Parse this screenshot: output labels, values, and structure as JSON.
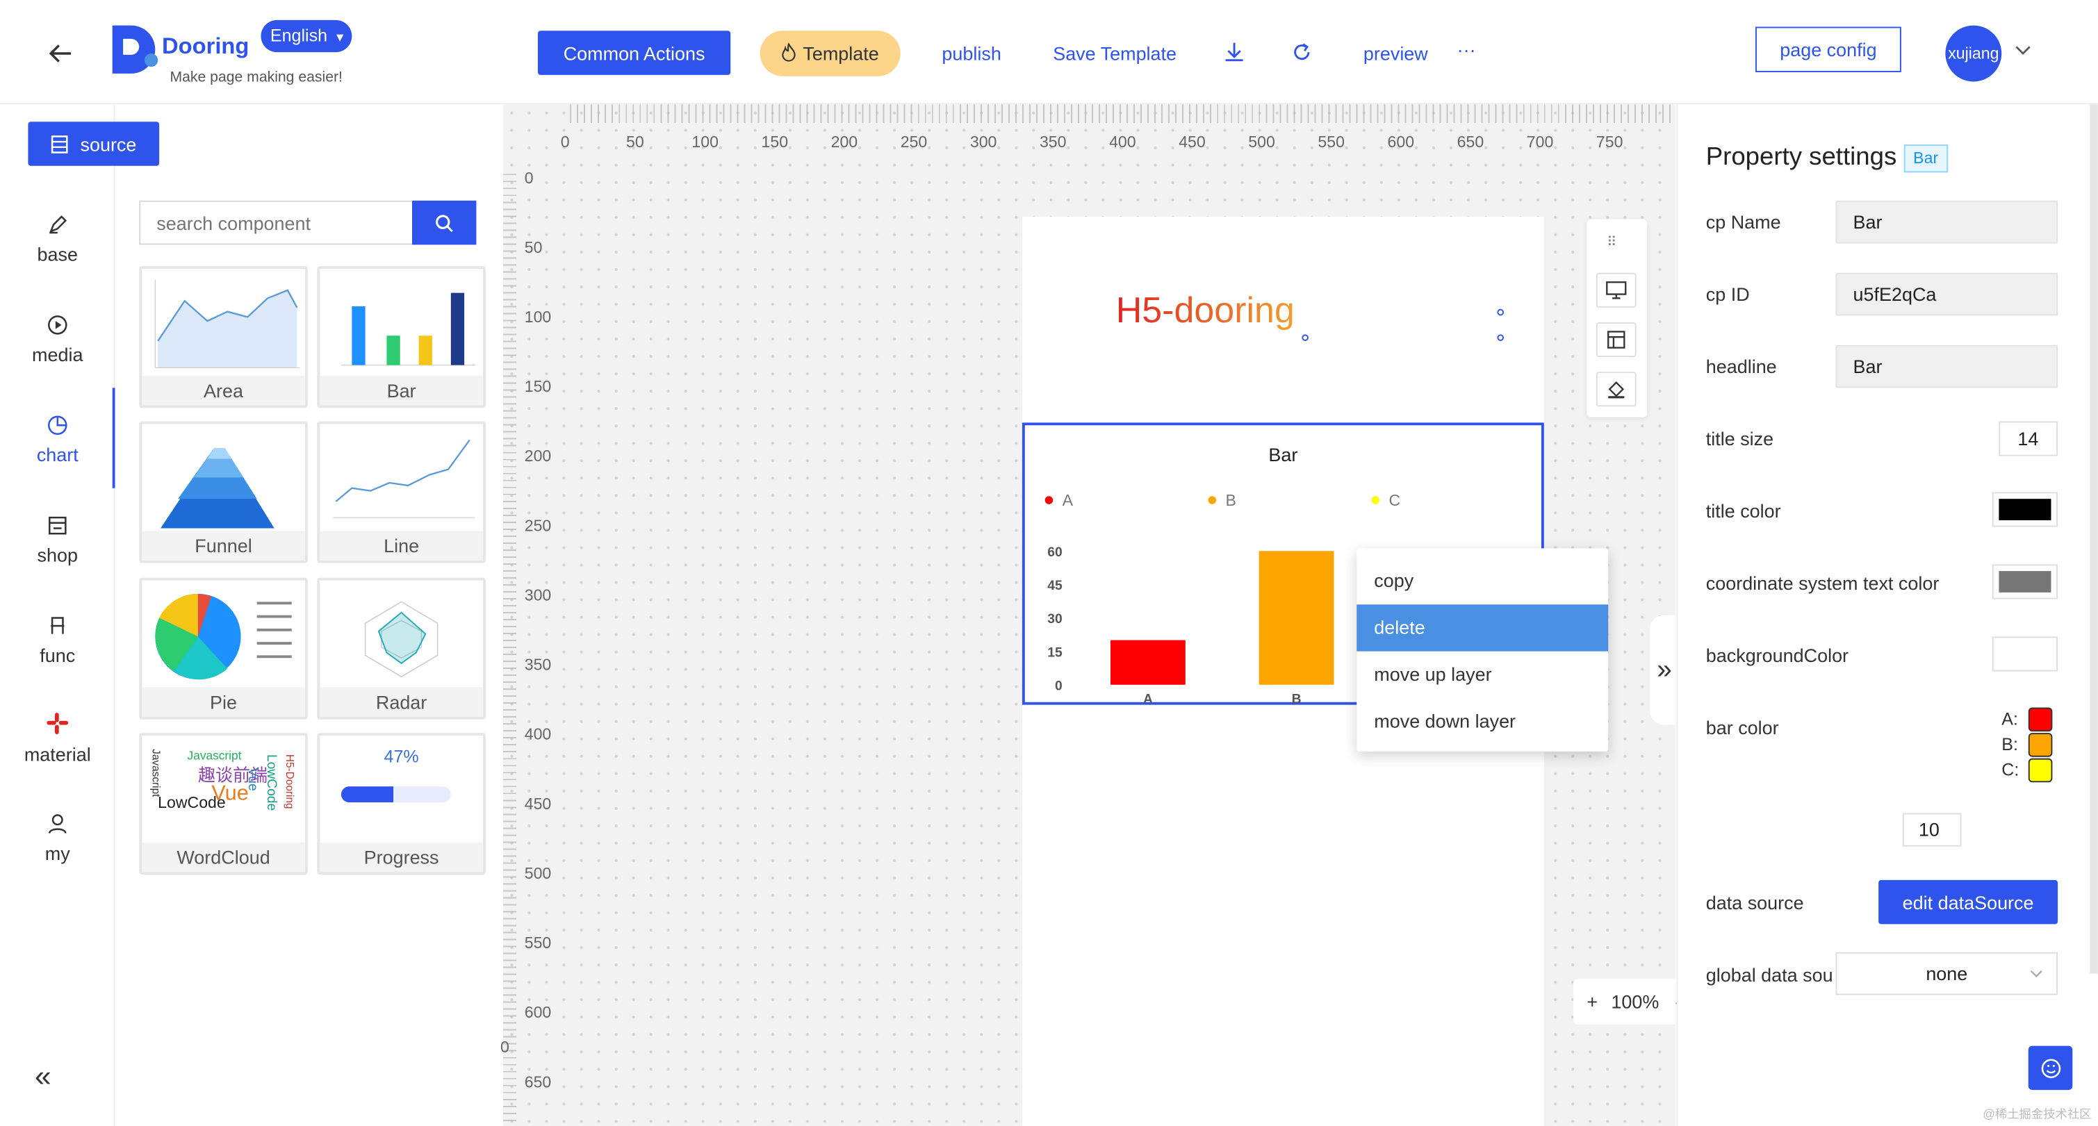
{
  "header": {
    "logo_text": "Dooring",
    "language": "English",
    "tagline": "Make page making easier!",
    "common_actions": "Common Actions",
    "template": "Template",
    "publish": "publish",
    "save_template": "Save Template",
    "preview": "preview",
    "more": "···",
    "page_config": "page config",
    "user": "xujiang"
  },
  "source_button": "source",
  "sidebar": {
    "items": [
      {
        "label": "base",
        "icon": "pen-icon"
      },
      {
        "label": "media",
        "icon": "play-icon"
      },
      {
        "label": "chart",
        "icon": "pie-chart-icon"
      },
      {
        "label": "shop",
        "icon": "shop-icon"
      },
      {
        "label": "func",
        "icon": "chair-icon"
      },
      {
        "label": "material",
        "icon": "slack-icon"
      },
      {
        "label": "my",
        "icon": "user-icon"
      }
    ],
    "active": "chart",
    "collapse": "«"
  },
  "search": {
    "placeholder": "search component"
  },
  "components": [
    "Area",
    "Bar",
    "Funnel",
    "Line",
    "Pie",
    "Radar",
    "WordCloud",
    "Progress"
  ],
  "progress_thumb": "47%",
  "ruler": {
    "h": [
      "0",
      "50",
      "100",
      "150",
      "200",
      "250",
      "300",
      "350",
      "400",
      "450",
      "500",
      "550",
      "600",
      "650",
      "700",
      "750"
    ],
    "v": [
      "0",
      "50",
      "100",
      "150",
      "200",
      "250",
      "300",
      "350",
      "400",
      "450",
      "500",
      "550",
      "600",
      "650"
    ],
    "corner_zero": "0"
  },
  "canvas": {
    "heading": "H5-dooring",
    "chart_title": "Bar",
    "legend": [
      "A",
      "B",
      "C"
    ],
    "y_ticks": [
      "60",
      "45",
      "30",
      "15",
      "0"
    ],
    "x_labels": [
      "A",
      "B"
    ]
  },
  "chart_data": {
    "type": "bar",
    "title": "Bar",
    "categories": [
      "A",
      "B",
      "C"
    ],
    "values": [
      20,
      60,
      null
    ],
    "colors": [
      "#ff0000",
      "#ffa500",
      "#ffff00"
    ],
    "ylim": [
      0,
      60
    ],
    "y_ticks": [
      0,
      15,
      30,
      45,
      60
    ],
    "legend_position": "top"
  },
  "context_menu": [
    "copy",
    "delete",
    "move up layer",
    "move down layer"
  ],
  "context_menu_highlight": "delete",
  "zoom": {
    "plus": "+",
    "value": "100%",
    "minus": "-"
  },
  "expand": "»",
  "props": {
    "title": "Property settings",
    "badge": "Bar",
    "cp_name_label": "cp Name",
    "cp_name": "Bar",
    "cp_id_label": "cp ID",
    "cp_id": "u5fE2qCa",
    "headline_label": "headline",
    "headline": "Bar",
    "title_size_label": "title size",
    "title_size": "14",
    "title_color_label": "title color",
    "title_color": "#000000",
    "coord_color_label": "coordinate system text color",
    "coord_color": "#777777",
    "bg_color_label": "backgroundColor",
    "bar_color_label": "bar color",
    "bar_colors": [
      {
        "name": "A:",
        "color": "#ff0000"
      },
      {
        "name": "B:",
        "color": "#ffa500"
      },
      {
        "name": "C:",
        "color": "#ffff00"
      }
    ],
    "number_value": "10",
    "data_source_label": "data source",
    "edit_data_source": "edit dataSource",
    "global_data_label": "global data sou",
    "global_data": "none"
  },
  "watermark": "@稀土掘金技术社区",
  "colors": {
    "accent": "#2f54eb",
    "template_bg": "#fcd48a",
    "highlight": "#4a90e2"
  }
}
